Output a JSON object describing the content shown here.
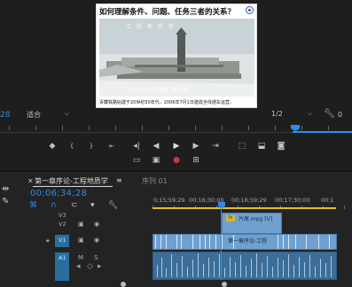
{
  "monitor": {
    "video": {
      "title": "如何理解条件、问题、任务三者的关系？",
      "overlay_line1": "工 程 地 质 学",
      "overlay_line2": "© 2022 JGU 平台数据 · 版权所有",
      "caption": "青藏铁路始建于20世纪50年代，2006年7月1日建成全线通车运营。"
    },
    "timecode": "28",
    "fit_label": "适合",
    "fraction_label": "1/2",
    "duration_tc": "0",
    "transport": {
      "marker_icon": "marker-icon",
      "play_icon": "play-icon"
    }
  },
  "timeline": {
    "tab_active": "第一章序论-工程地质学",
    "tab_inactive": "序列 01",
    "timecode": "00;06;34;28",
    "ruler_labels": [
      "0;15;59;29",
      "00;16;30;00",
      "00;16;59;29",
      "00;17;30;00",
      "00;1"
    ],
    "tracks": {
      "v3": "V3",
      "v2": "V2",
      "v1": "V1",
      "a1": "A1"
    },
    "v2_clip_label": "片尾.mpg [V]",
    "v1_clip_label": "第一章序论-工程"
  },
  "colors": {
    "accent_blue": "#2d8ceb",
    "work_area_yellow": "#e3c11f",
    "video_clip": "#6fa0cf",
    "audio_clip": "#3c6e99"
  }
}
